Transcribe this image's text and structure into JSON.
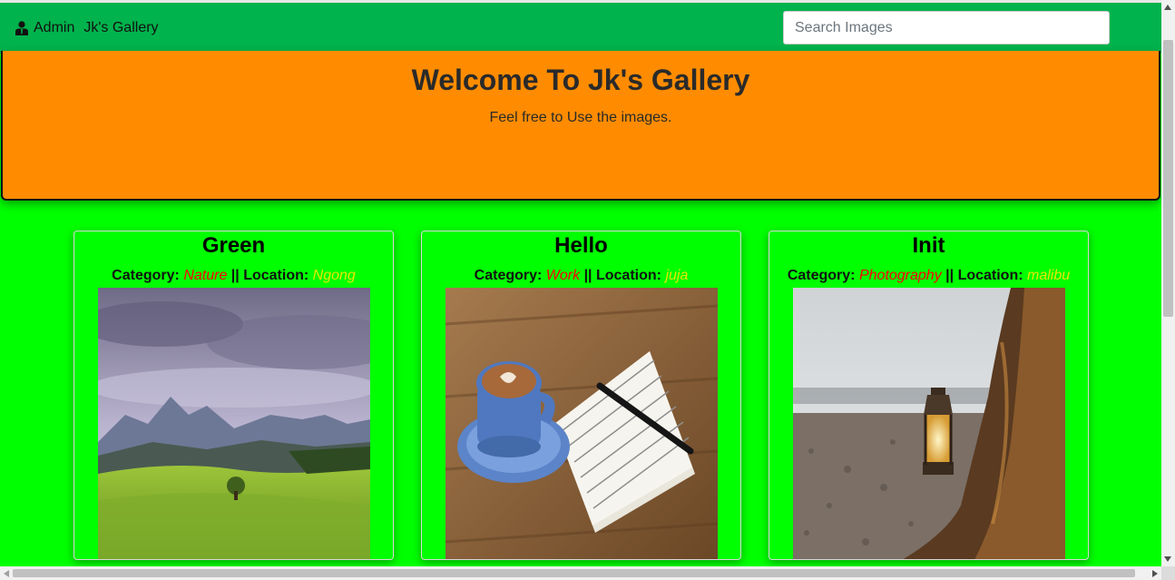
{
  "navbar": {
    "admin_label": "Admin",
    "brand_label": "Jk's Gallery",
    "search_placeholder": "Search Images"
  },
  "hero": {
    "title": "Welcome To Jk's Gallery",
    "subtitle": "Feel free to Use the images."
  },
  "labels": {
    "category": "Category:",
    "location": "Location:",
    "separator": "||"
  },
  "cards": [
    {
      "title": "Green",
      "category": "Nature",
      "location": "Ngong",
      "image": "landscape-mountains-meadow"
    },
    {
      "title": "Hello",
      "category": "Work",
      "location": "juja",
      "image": "coffee-cup-notebook-pen"
    },
    {
      "title": "Init",
      "category": "Photography",
      "location": "malibu",
      "image": "lantern-on-tree-stump"
    }
  ],
  "colors": {
    "navbar": "#00b34c",
    "hero": "#ff8c00",
    "page_background": "#00ff00",
    "category_text": "#ff0000",
    "location_text": "#e6e600"
  }
}
